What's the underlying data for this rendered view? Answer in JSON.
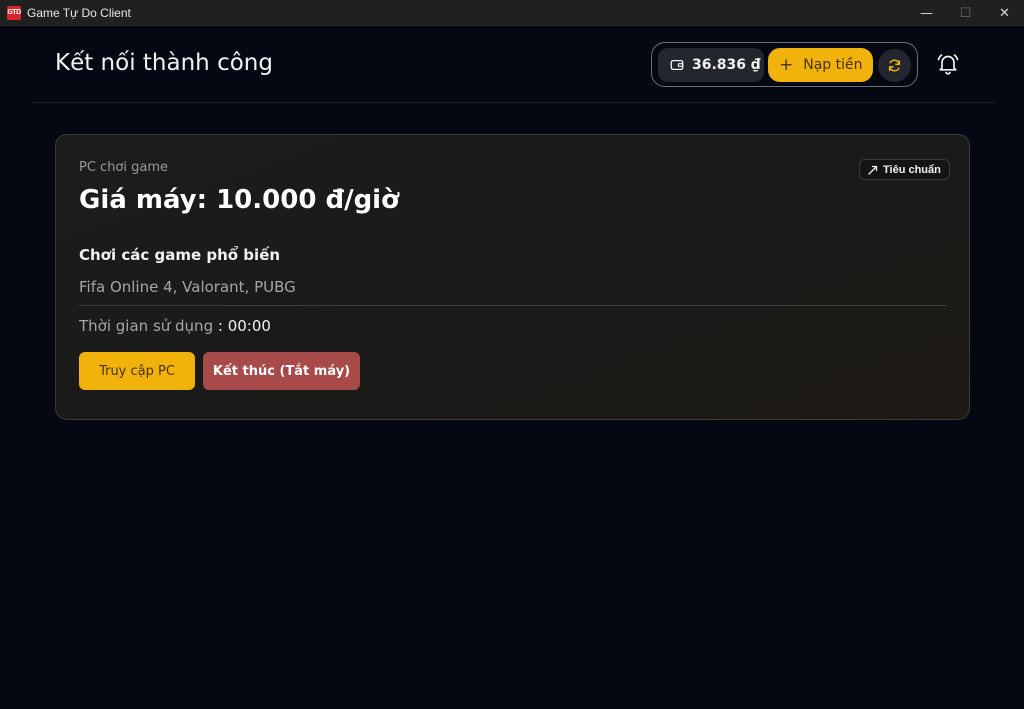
{
  "window": {
    "logo_text": "GTD",
    "title": "Game Tự Do Client",
    "minimize": "—",
    "maximize": "☐",
    "close": "✕"
  },
  "header": {
    "title": "Kết nối thành công",
    "balance": "36.836 ₫",
    "topup_label": "Nạp tiền",
    "topup_plus": "+",
    "icons": [
      "wallet-icon",
      "plus-icon",
      "refresh-icon",
      "bell-icon"
    ]
  },
  "card": {
    "subtitle": "PC chơi game",
    "badge": "Tiêu chuẩn",
    "price": "Giá máy: 10.000 đ/giờ",
    "games_title": "Chơi các game phổ biến",
    "games_list": "Fifa Online 4, Valorant, PUBG",
    "usage_label": "Thời gian sử dụng",
    "usage_sep": " : ",
    "usage_value": "00:00",
    "access_button": "Truy cập PC",
    "end_button": "Kết thúc (Tắt máy)"
  },
  "colors": {
    "accent": "#f2b20c",
    "danger": "#a84a4a",
    "background": "#050812",
    "card": "#1c1c1c"
  }
}
